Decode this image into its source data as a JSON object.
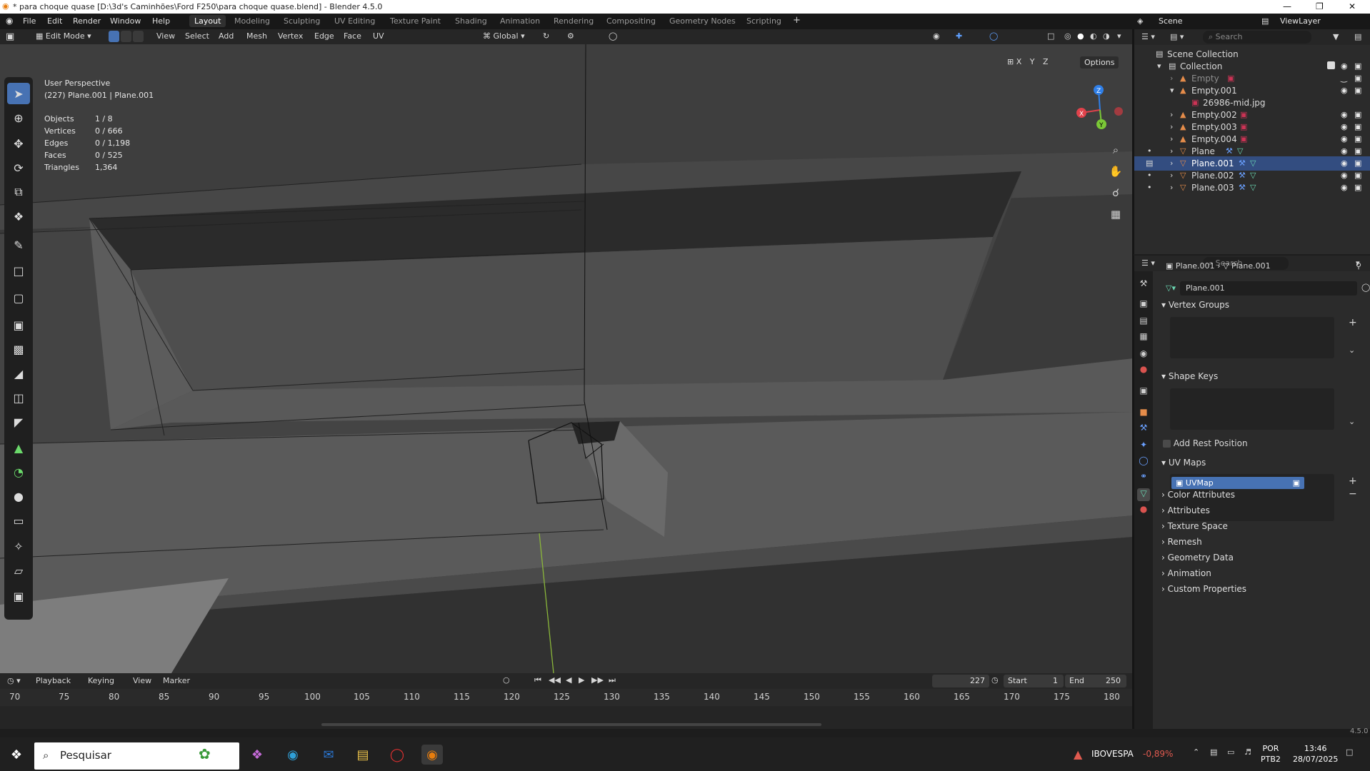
{
  "window": {
    "title": "* para choque quase [D:\\3d's Caminhões\\Ford F250\\para choque quase.blend] - Blender 4.5.0",
    "minimize": "—",
    "maximize": "❐",
    "close": "✕"
  },
  "menus": [
    "File",
    "Edit",
    "Render",
    "Window",
    "Help"
  ],
  "workspaces": [
    "Layout",
    "Modeling",
    "Sculpting",
    "UV Editing",
    "Texture Paint",
    "Shading",
    "Animation",
    "Rendering",
    "Compositing",
    "Geometry Nodes",
    "Scripting"
  ],
  "active_workspace": "Layout",
  "scene": "Scene",
  "view_layer": "ViewLayer",
  "header3d": {
    "mode": "Edit Mode",
    "menus": [
      "View",
      "Select",
      "Add",
      "Mesh",
      "Vertex",
      "Edge",
      "Face",
      "UV"
    ],
    "orientation": "Global",
    "options": "Options",
    "axes": [
      "X",
      "Y",
      "Z"
    ]
  },
  "overlay": {
    "view_name": "User Perspective",
    "object_line": "(227) Plane.001 | Plane.001"
  },
  "stats": [
    {
      "k": "Objects",
      "v": "1 / 8"
    },
    {
      "k": "Vertices",
      "v": "0 / 666"
    },
    {
      "k": "Edges",
      "v": "0 / 1,198"
    },
    {
      "k": "Faces",
      "v": "0 / 525"
    },
    {
      "k": "Triangles",
      "v": "1,364"
    }
  ],
  "gizmo": {
    "x": "X",
    "y": "Y",
    "z": "Z"
  },
  "timeline": {
    "menus": [
      "Playback",
      "Keying",
      "View",
      "Marker"
    ],
    "current_frame": "227",
    "start_label": "Start",
    "start": "1",
    "end_label": "End",
    "end": "250",
    "ticks": [
      "70",
      "75",
      "80",
      "85",
      "90",
      "95",
      "100",
      "105",
      "110",
      "115",
      "120",
      "125",
      "130",
      "135",
      "140",
      "145",
      "150",
      "155",
      "160",
      "165",
      "170",
      "175",
      "180"
    ]
  },
  "outliner": {
    "search_placeholder": "Search",
    "root": "Scene Collection",
    "collection": "Collection",
    "items": [
      {
        "name": "Empty",
        "dim": true
      },
      {
        "name": "Empty.001",
        "dim": false
      },
      {
        "name": "26986-mid.jpg",
        "dim": false,
        "child": true
      },
      {
        "name": "Empty.002",
        "dim": false
      },
      {
        "name": "Empty.003",
        "dim": false
      },
      {
        "name": "Empty.004",
        "dim": false
      },
      {
        "name": "Plane",
        "dim": false
      },
      {
        "name": "Plane.001",
        "dim": false,
        "selected": true
      },
      {
        "name": "Plane.002",
        "dim": false
      },
      {
        "name": "Plane.003",
        "dim": false
      }
    ]
  },
  "properties": {
    "search_placeholder": "Search",
    "breadcrumb_object": "Plane.001",
    "breadcrumb_data": "Plane.001",
    "mesh_name": "Plane.001",
    "sections": {
      "vertex_groups": "Vertex Groups",
      "shape_keys": "Shape Keys",
      "add_rest_position": "Add Rest Position",
      "uv_maps": "UV Maps",
      "uv_map_item": "UVMap"
    },
    "collapsed": [
      "Color Attributes",
      "Attributes",
      "Texture Space",
      "Remesh",
      "Geometry Data",
      "Animation",
      "Custom Properties"
    ]
  },
  "version": "4.5.0",
  "taskbar": {
    "search_placeholder": "Pesquisar",
    "ticker_name": "IBOVESPA",
    "ticker_value": "-0,89%",
    "lang": "POR",
    "kbd": "PTB2",
    "time": "13:46",
    "date": "28/07/2025"
  },
  "colors": {
    "accent": "#4772b3",
    "select_row": "#334d80",
    "ticker_red": "#e05a4f",
    "axis_x": "#e0424b",
    "axis_y": "#7bc837",
    "axis_z": "#2f7fe8"
  }
}
